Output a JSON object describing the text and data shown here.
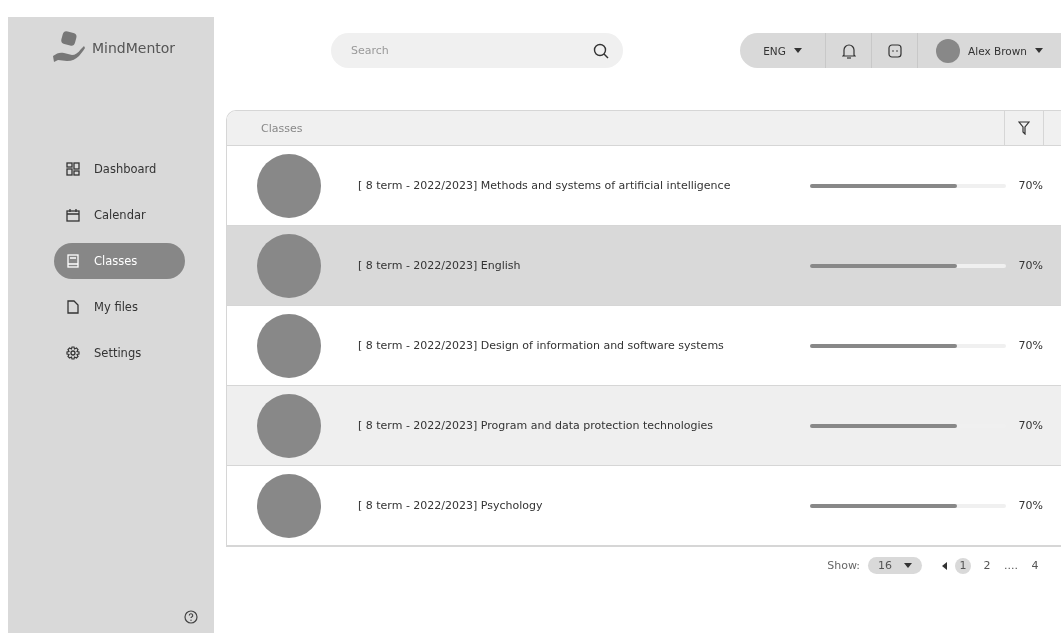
{
  "sidebar": {
    "logo": "MindMentor",
    "items": [
      {
        "label": "Dashboard",
        "selected": false
      },
      {
        "label": "Calendar",
        "selected": false
      },
      {
        "label": "Classes",
        "selected": true
      },
      {
        "label": "My files",
        "selected": false
      },
      {
        "label": "Settings",
        "selected": false
      }
    ]
  },
  "header": {
    "search": {
      "placeholder": "Search"
    },
    "language": "ENG",
    "user": "Alex Brown"
  },
  "table": {
    "title": "Classes",
    "rows": [
      {
        "name": "[ 8 term - 2022/2023] Methods and systems of artificial intelligence",
        "level": 0.75,
        "reading": "70%",
        "selected": false
      },
      {
        "name": "[ 8 term - 2022/2023] English",
        "level": 0.75,
        "reading": "70%",
        "selected": true
      },
      {
        "name": "[ 8 term - 2022/2023] Design of information and software systems",
        "level": 0.75,
        "reading": "70%",
        "selected": false
      },
      {
        "name": "[ 8 term - 2022/2023] Program and data protection technologies",
        "level": 0.75,
        "reading": "70%",
        "selected": false
      },
      {
        "name": "[ 8 term - 2022/2023] Psychology",
        "level": 0.75,
        "reading": "70%",
        "selected": false
      }
    ]
  },
  "pagination": {
    "show_label": "Show:",
    "page_size": "16",
    "pages": [
      {
        "label": "1",
        "selected": true
      },
      {
        "label": "2",
        "selected": false
      },
      {
        "label": "....",
        "selected": false
      },
      {
        "label": "4",
        "selected": false
      }
    ]
  }
}
